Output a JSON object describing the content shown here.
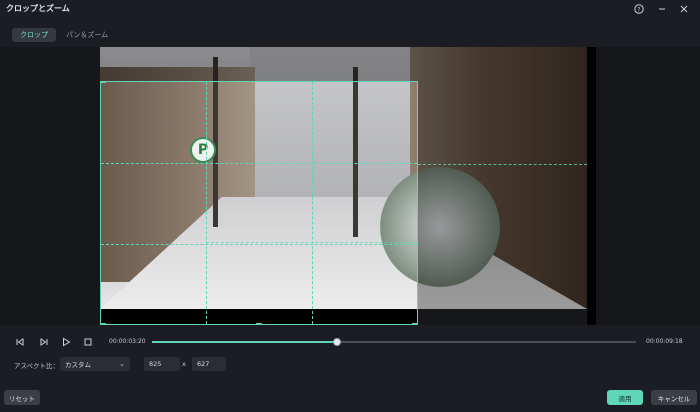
{
  "window": {
    "title": "クロップとズーム",
    "help_icon": "help-icon",
    "minimize_icon": "minimize-icon",
    "close_icon": "close-icon"
  },
  "tabs": [
    {
      "label": "クロップ",
      "active": true
    },
    {
      "label": "パン＆ズーム",
      "active": false
    }
  ],
  "preview": {
    "sign_letter": "P"
  },
  "playback": {
    "current_time": "00:00:03:20",
    "total_time": "00:00:09:18",
    "progress_fraction": 0.38
  },
  "aspect": {
    "label": "アスペクト比：",
    "selected": "カスタム",
    "width": "825",
    "times": "x",
    "height": "627"
  },
  "footer": {
    "reset_label": "リセット",
    "apply_label": "適用",
    "cancel_label": "キャンセル"
  },
  "colors": {
    "accent": "#5fd7b7",
    "background": "#1b1d22"
  }
}
